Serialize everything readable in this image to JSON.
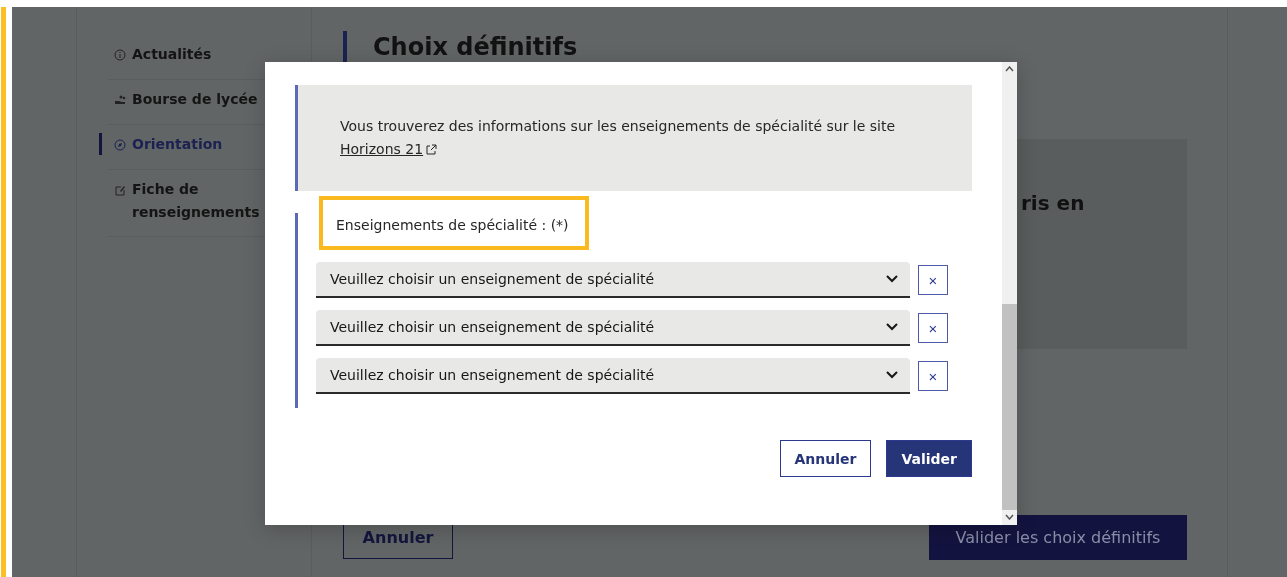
{
  "sidebar": {
    "items": [
      {
        "label": "Actualités",
        "selected": false
      },
      {
        "label": "Bourse de lycée",
        "selected": false
      },
      {
        "label": "Orientation",
        "selected": true
      },
      {
        "label": "Fiche de renseignements",
        "selected": false
      }
    ]
  },
  "page": {
    "title": "Choix définitifs",
    "card_text": "ris en",
    "cancel_button": "Annuler",
    "submit_button": "Valider les choix définitifs"
  },
  "modal": {
    "info_text": "Vous trouverez des informations sur les enseignements de spécialité sur le site",
    "info_link": "Horizons 21",
    "field_label": "Enseignements de spécialité : (*)",
    "field_label_highlighted": true,
    "selects": [
      {
        "value": "Veuillez choisir un enseignement de spécialité",
        "remove": "×"
      },
      {
        "value": "Veuillez choisir un enseignement de spécialité",
        "remove": "×"
      },
      {
        "value": "Veuillez choisir un enseignement de spécialité",
        "remove": "×"
      }
    ],
    "buttons": [
      {
        "label": "Annuler",
        "kind": "secondary"
      },
      {
        "label": "Valider",
        "kind": "primary"
      }
    ]
  }
}
